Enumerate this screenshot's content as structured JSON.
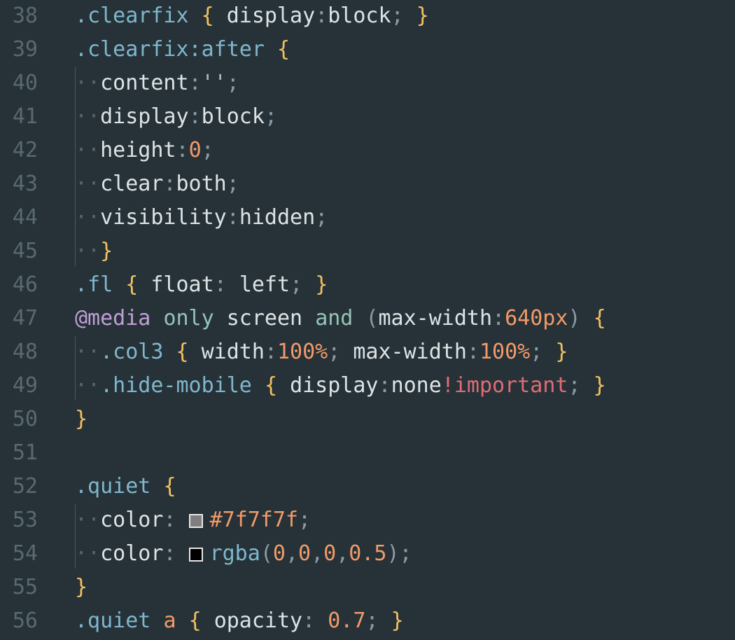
{
  "editor": {
    "lines": [
      {
        "n": "38",
        "tokens": [
          [
            "sel",
            ".clearfix"
          ],
          [
            "",
            " "
          ],
          [
            "brace",
            "{"
          ],
          [
            "",
            " "
          ],
          [
            "prop",
            "display"
          ],
          [
            "punct",
            ":"
          ],
          [
            "val",
            "block"
          ],
          [
            "punct",
            ";"
          ],
          [
            "",
            " "
          ],
          [
            "brace",
            "}"
          ]
        ]
      },
      {
        "n": "39",
        "tokens": [
          [
            "sel",
            ".clearfix:after"
          ],
          [
            "",
            " "
          ],
          [
            "brace",
            "{"
          ]
        ]
      },
      {
        "n": "40",
        "tokens": [
          [
            "ws",
            "··"
          ],
          [
            "prop",
            "content"
          ],
          [
            "punct",
            ":"
          ],
          [
            "str",
            "''"
          ],
          [
            "punct",
            ";"
          ]
        ]
      },
      {
        "n": "41",
        "tokens": [
          [
            "ws",
            "··"
          ],
          [
            "prop",
            "display"
          ],
          [
            "punct",
            ":"
          ],
          [
            "val",
            "block"
          ],
          [
            "punct",
            ";"
          ]
        ]
      },
      {
        "n": "42",
        "tokens": [
          [
            "ws",
            "··"
          ],
          [
            "prop",
            "height"
          ],
          [
            "punct",
            ":"
          ],
          [
            "num",
            "0"
          ],
          [
            "punct",
            ";"
          ]
        ]
      },
      {
        "n": "43",
        "tokens": [
          [
            "ws",
            "··"
          ],
          [
            "prop",
            "clear"
          ],
          [
            "punct",
            ":"
          ],
          [
            "val",
            "both"
          ],
          [
            "punct",
            ";"
          ]
        ]
      },
      {
        "n": "44",
        "tokens": [
          [
            "ws",
            "··"
          ],
          [
            "prop",
            "visibility"
          ],
          [
            "punct",
            ":"
          ],
          [
            "val",
            "hidden"
          ],
          [
            "punct",
            ";"
          ]
        ]
      },
      {
        "n": "45",
        "tokens": [
          [
            "ws",
            "··"
          ],
          [
            "brace",
            "}"
          ]
        ]
      },
      {
        "n": "46",
        "tokens": [
          [
            "sel",
            ".fl"
          ],
          [
            "",
            " "
          ],
          [
            "brace",
            "{"
          ],
          [
            "",
            " "
          ],
          [
            "prop",
            "float"
          ],
          [
            "punct",
            ":"
          ],
          [
            "",
            " "
          ],
          [
            "val",
            "left"
          ],
          [
            "punct",
            ";"
          ],
          [
            "",
            " "
          ],
          [
            "brace",
            "}"
          ]
        ]
      },
      {
        "n": "47",
        "tokens": [
          [
            "at",
            "@media"
          ],
          [
            "",
            " "
          ],
          [
            "kw",
            "only"
          ],
          [
            "",
            " "
          ],
          [
            "val",
            "screen"
          ],
          [
            "",
            " "
          ],
          [
            "kw",
            "and"
          ],
          [
            "",
            " "
          ],
          [
            "punct",
            "("
          ],
          [
            "prop",
            "max-width"
          ],
          [
            "punct",
            ":"
          ],
          [
            "num",
            "640px"
          ],
          [
            "punct",
            ")"
          ],
          [
            "",
            " "
          ],
          [
            "brace",
            "{"
          ]
        ]
      },
      {
        "n": "48",
        "tokens": [
          [
            "ws",
            "··"
          ],
          [
            "sel",
            ".col3"
          ],
          [
            "",
            " "
          ],
          [
            "brace",
            "{"
          ],
          [
            "",
            " "
          ],
          [
            "prop",
            "width"
          ],
          [
            "punct",
            ":"
          ],
          [
            "num",
            "100%"
          ],
          [
            "punct",
            ";"
          ],
          [
            "",
            " "
          ],
          [
            "prop",
            "max-width"
          ],
          [
            "punct",
            ":"
          ],
          [
            "num",
            "100%"
          ],
          [
            "punct",
            ";"
          ],
          [
            "",
            " "
          ],
          [
            "brace",
            "}"
          ]
        ]
      },
      {
        "n": "49",
        "tokens": [
          [
            "ws",
            "··"
          ],
          [
            "sel",
            ".hide-mobile"
          ],
          [
            "",
            " "
          ],
          [
            "brace",
            "{"
          ],
          [
            "",
            " "
          ],
          [
            "prop",
            "display"
          ],
          [
            "punct",
            ":"
          ],
          [
            "val",
            "none"
          ],
          [
            "imp",
            "!important"
          ],
          [
            "punct",
            ";"
          ],
          [
            "",
            " "
          ],
          [
            "brace",
            "}"
          ]
        ]
      },
      {
        "n": "50",
        "tokens": [
          [
            "brace",
            "}"
          ]
        ]
      },
      {
        "n": "51",
        "tokens": []
      },
      {
        "n": "52",
        "tokens": [
          [
            "sel",
            ".quiet"
          ],
          [
            "",
            " "
          ],
          [
            "brace",
            "{"
          ]
        ]
      },
      {
        "n": "53",
        "tokens": [
          [
            "ws",
            "··"
          ],
          [
            "prop",
            "color"
          ],
          [
            "punct",
            ":"
          ],
          [
            "",
            " "
          ],
          [
            "swatch",
            "#7f7f7f"
          ],
          [
            "num",
            "#7f7f7f"
          ],
          [
            "punct",
            ";"
          ]
        ]
      },
      {
        "n": "54",
        "tokens": [
          [
            "ws",
            "··"
          ],
          [
            "prop",
            "color"
          ],
          [
            "punct",
            ":"
          ],
          [
            "",
            " "
          ],
          [
            "swatch",
            "#000000"
          ],
          [
            "sel",
            "rgba"
          ],
          [
            "punct",
            "("
          ],
          [
            "num",
            "0"
          ],
          [
            "punct",
            ","
          ],
          [
            "num",
            "0"
          ],
          [
            "punct",
            ","
          ],
          [
            "num",
            "0"
          ],
          [
            "punct",
            ","
          ],
          [
            "num",
            "0.5"
          ],
          [
            "punct",
            ")"
          ],
          [
            "punct",
            ";"
          ]
        ]
      },
      {
        "n": "55",
        "tokens": [
          [
            "brace",
            "}"
          ]
        ]
      },
      {
        "n": "56",
        "tokens": [
          [
            "sel",
            ".quiet"
          ],
          [
            "",
            " "
          ],
          [
            "tag",
            "a"
          ],
          [
            "",
            " "
          ],
          [
            "brace",
            "{"
          ],
          [
            "",
            " "
          ],
          [
            "prop",
            "opacity"
          ],
          [
            "punct",
            ":"
          ],
          [
            "",
            " "
          ],
          [
            "num",
            "0.7"
          ],
          [
            "punct",
            ";"
          ],
          [
            "",
            " "
          ],
          [
            "brace",
            "}"
          ]
        ]
      }
    ]
  }
}
